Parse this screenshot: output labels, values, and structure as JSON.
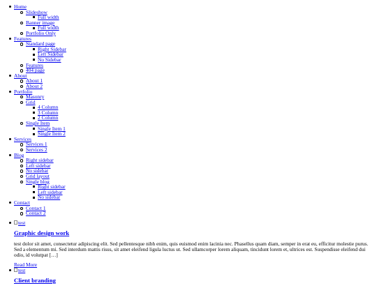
{
  "nav": [
    {
      "label": "Home",
      "children": [
        {
          "label": "Slideshow",
          "children": [
            {
              "label": "Full width"
            }
          ]
        },
        {
          "label": "Banner image",
          "children": [
            {
              "label": "Full width"
            }
          ]
        },
        {
          "label": "Portfolio Only"
        }
      ]
    },
    {
      "label": "Features",
      "children": [
        {
          "label": "Standard page",
          "children": [
            {
              "label": "Right Sidebar"
            },
            {
              "label": "Left Sidebar"
            },
            {
              "label": "No Sidebar"
            }
          ]
        },
        {
          "label": "Features"
        },
        {
          "label": "404 page"
        }
      ]
    },
    {
      "label": "About",
      "children": [
        {
          "label": "About 1"
        },
        {
          "label": "About 2"
        }
      ]
    },
    {
      "label": "Portfolio",
      "children": [
        {
          "label": "Masonry"
        },
        {
          "label": "Grid",
          "children": [
            {
              "label": "4 Column"
            },
            {
              "label": "3 Column"
            },
            {
              "label": "2 Column"
            }
          ]
        },
        {
          "label": "Single Item",
          "children": [
            {
              "label": "Single Item 1"
            },
            {
              "label": "Single Item 2"
            }
          ]
        }
      ]
    },
    {
      "label": "Services",
      "children": [
        {
          "label": "Services 1"
        },
        {
          "label": "Services 2"
        }
      ]
    },
    {
      "label": "Blog",
      "children": [
        {
          "label": "Right sidebar"
        },
        {
          "label": "Left sidebar"
        },
        {
          "label": "No sidebar"
        },
        {
          "label": "Grid layout"
        },
        {
          "label": "Single blog",
          "children": [
            {
              "label": "Right sidebar"
            },
            {
              "label": "Left sidebar"
            },
            {
              "label": "No sidebar"
            }
          ]
        }
      ]
    },
    {
      "label": "Contact",
      "children": [
        {
          "label": "Contact 1"
        },
        {
          "label": "Contact 2"
        }
      ]
    }
  ],
  "posts": [
    {
      "image_alt": "test",
      "title": "Graphic design work",
      "excerpt": "test dolor sit amet, consectetur adipiscing elit. Sed pellentesque nibh enim, quis euismod enim lacinia nec. Phasellus quam diam, semper in erat eu, efficitur molestie purus. Sed a elementum mi. Sed interdum mattis risus, sit amet eleifend ligula luctus ut. Sed ullamcorper lorem aliquam, tincidunt lorem et, ultrices est. Suspendisse eleifend dui odio, id volutpat […]",
      "read_more": "Read More"
    },
    {
      "image_alt": "test",
      "title": "Client branding"
    }
  ]
}
